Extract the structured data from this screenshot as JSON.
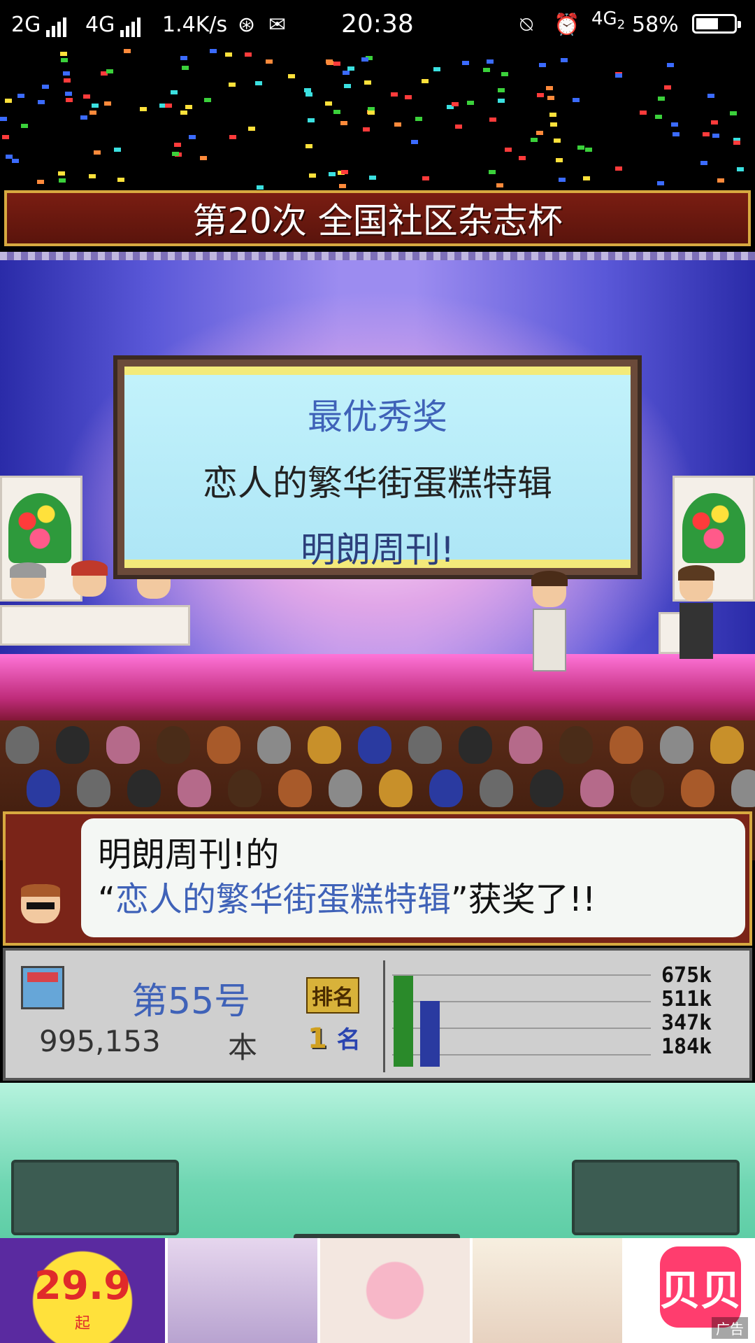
{
  "status_bar": {
    "network1": "2G",
    "network2": "4G",
    "speed": "1.4K/s",
    "time": "20:38",
    "network3": "4G",
    "network3_sub": "2",
    "battery": "58%",
    "battery_level": 0.58
  },
  "event": {
    "title": "第20次 全国社区杂志杯"
  },
  "award_panel": {
    "award": "最优秀奖",
    "work": "恋人的繁华街蛋糕特辑",
    "magazine": "明朗周刊!"
  },
  "dialog": {
    "line1": "明朗周刊!的",
    "quote_open": "“",
    "work": "恋人的繁华街蛋糕特辑",
    "quote_close": "”获奖了!!"
  },
  "stats": {
    "issue": "第55号",
    "copies": "995,153",
    "copies_unit": "本",
    "rank_label": "排名",
    "rank_value": "1",
    "rank_unit": "名",
    "chart_ticks": [
      "675k",
      "511k",
      "347k",
      "184k"
    ]
  },
  "chart_data": {
    "type": "bar",
    "series": [
      {
        "values": [
          1.0
        ],
        "color": "#2a8a2a"
      },
      {
        "values": [
          0.72
        ],
        "color": "#2a3aa0"
      }
    ],
    "tick_labels": [
      "675k",
      "511k",
      "347k",
      "184k"
    ]
  },
  "ad": {
    "price": "29.9",
    "price_suffix": "起",
    "brand_text": "贝贝",
    "ad_label": "广告"
  },
  "colors": {
    "accent_blue": "#3f62b8",
    "banner_red": "#7a1d12",
    "gold_border": "#d7a940",
    "mint_bg": "#6fd6b2"
  }
}
